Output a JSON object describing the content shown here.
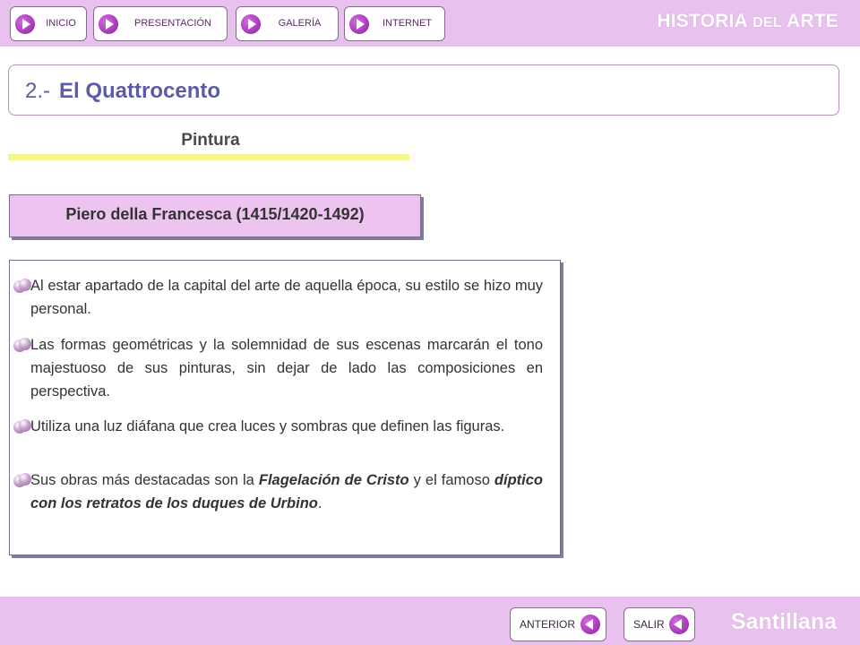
{
  "nav": {
    "items": [
      {
        "label": "INICIO"
      },
      {
        "label": "PRESENTACIÓN"
      },
      {
        "label": "GALERÍA"
      },
      {
        "label": "INTERNET"
      }
    ]
  },
  "brand": {
    "title_part1": "HISTORIA ",
    "title_part2": "DEL",
    "title_part3": " ARTE",
    "footer": "Santillana"
  },
  "section": {
    "number": "2.-",
    "title": "El Quattrocento"
  },
  "subsection": "Pintura",
  "artist": "Piero della Francesca (1415/1420-1492)",
  "bullets": [
    {
      "text": "Al estar apartado de la capital del arte de aquella época, su estilo se hizo muy personal."
    },
    {
      "text": "Las formas geométricas y la solemnidad de sus escenas marcarán el tono majestuoso de sus pinturas, sin dejar de lado las composiciones en perspectiva."
    },
    {
      "text": "Utiliza una luz diáfana que crea luces y sombras que definen las figuras."
    },
    {
      "text_a": "Sus obras más destacadas son la ",
      "text_b": "Flagelación de Cristo",
      "text_c": " y el famoso ",
      "text_d": "díptico con los retratos de los duques de Urbino",
      "text_e": "."
    }
  ],
  "footer_nav": {
    "prev_label": "ANTERIOR",
    "exit_label": "SALIR"
  },
  "colors": {
    "bar": "#e9c1ee",
    "accent": "#8c1fa0",
    "title": "#5b5ca8",
    "highlight": "#f7f58e"
  }
}
